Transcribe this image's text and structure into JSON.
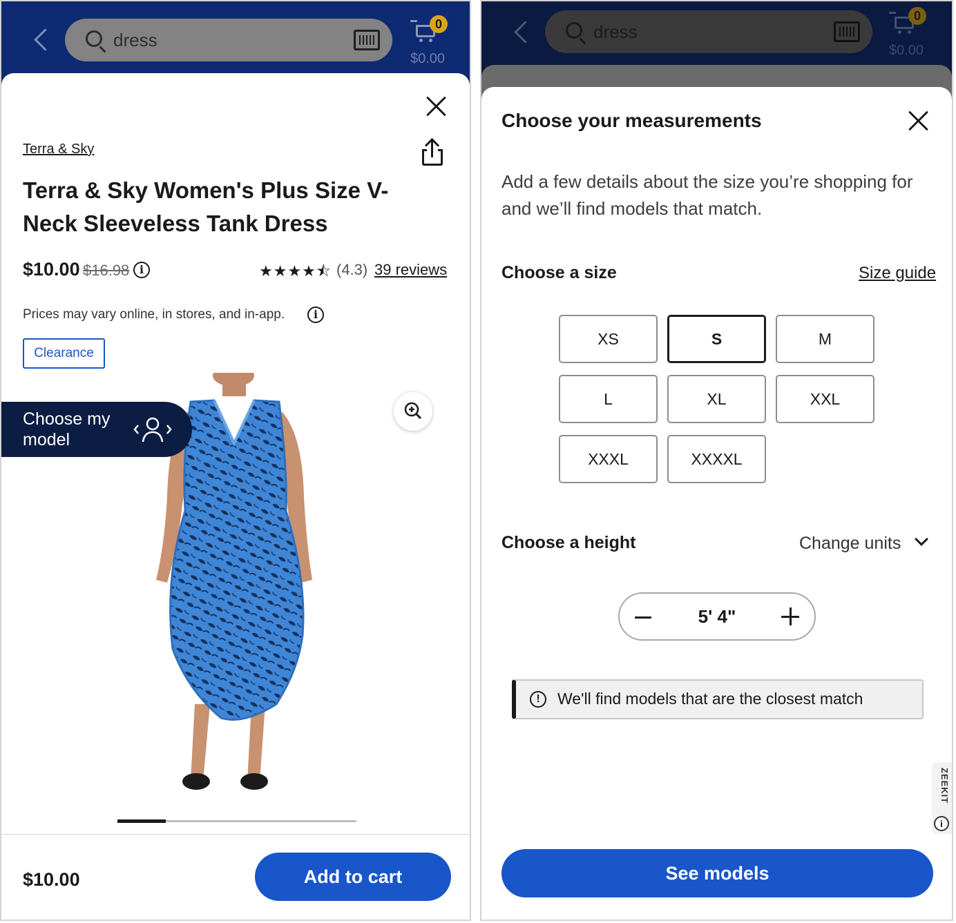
{
  "search": {
    "query": "dress"
  },
  "cart": {
    "count": "0",
    "total": "$0.00"
  },
  "product": {
    "brand": "Terra & Sky",
    "title": "Terra & Sky Women's Plus Size V-Neck Sleeveless Tank Dress",
    "price": "$10.00",
    "was_price": "$16.98",
    "stars": "★★★★⯪",
    "rating": "(4.3)",
    "reviews": "39 reviews",
    "price_note": "Prices may vary online, in stores, and in-app.",
    "tag": "Clearance",
    "rating_value": 4.3,
    "carousel_position": "1 of 5"
  },
  "model_picker": {
    "label": "Choose my model"
  },
  "bottom_bar": {
    "price": "$10.00",
    "add_to_cart": "Add to cart"
  },
  "measurements": {
    "title": "Choose your measurements",
    "description": "Add a few details about the size you’re shopping for and we’ll find models that match.",
    "size_section": "Choose a size",
    "size_guide": "Size guide",
    "sizes": [
      "XS",
      "S",
      "M",
      "L",
      "XL",
      "XXL",
      "XXXL",
      "XXXXL"
    ],
    "selected_size": "S",
    "height_section": "Choose a height",
    "change_units": "Change units",
    "height_value": "5' 4\"",
    "notice": "We'll find models that are the closest match",
    "zeekit": "ZEEKIT",
    "see_models": "See models"
  },
  "colors": {
    "header_blue": "#0e2a72",
    "primary_button": "#1856c9",
    "model_pill": "#0c1d44",
    "cart_badge": "#d8a51a",
    "dress_blue": "#3f86d6"
  },
  "icons": [
    "back-chevron",
    "search",
    "barcode-scanner",
    "cart",
    "close",
    "share",
    "info",
    "zoom-in",
    "model-person",
    "minus",
    "plus",
    "chevron-down"
  ]
}
